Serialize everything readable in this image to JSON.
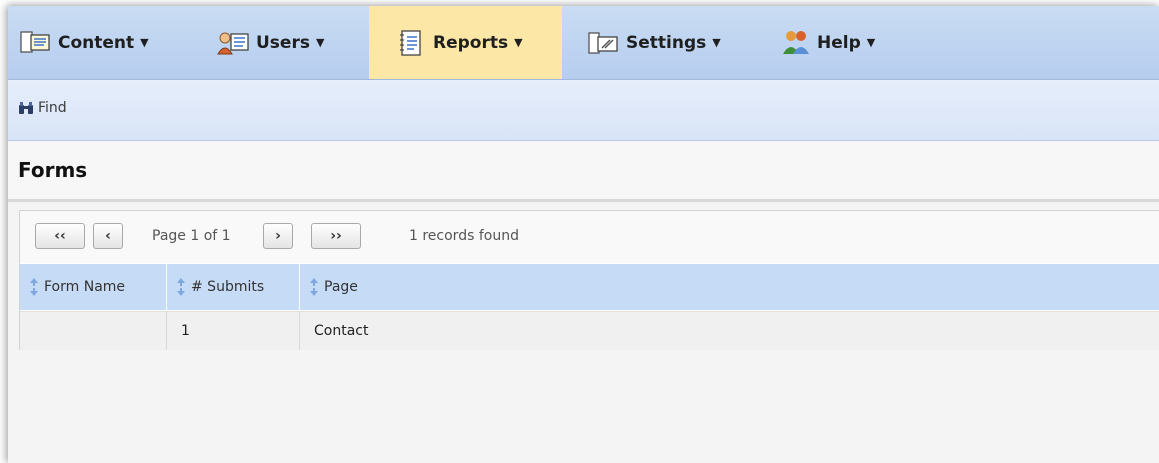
{
  "menu": {
    "items": [
      {
        "label": "Content",
        "icon": "content-icon"
      },
      {
        "label": "Users",
        "icon": "users-icon"
      },
      {
        "label": "Reports",
        "icon": "reports-icon",
        "active": true
      },
      {
        "label": "Settings",
        "icon": "settings-icon"
      },
      {
        "label": "Help",
        "icon": "help-icon"
      }
    ]
  },
  "toolbar": {
    "find_label": "Find"
  },
  "page": {
    "title": "Forms"
  },
  "pager": {
    "first": "‹‹",
    "prev": "‹",
    "page_text": "Page 1 of 1",
    "next": "›",
    "last": "››",
    "records_text": "1 records found"
  },
  "table": {
    "columns": [
      "Form Name",
      "# Submits",
      "Page"
    ],
    "rows": [
      [
        "",
        "1",
        "Contact"
      ]
    ]
  },
  "colors": {
    "menu_bg": "#c9dcf3",
    "menu_active": "#fce7a6",
    "toolbar_bg": "#dde7f8",
    "header_row": "#c6dbf5"
  }
}
